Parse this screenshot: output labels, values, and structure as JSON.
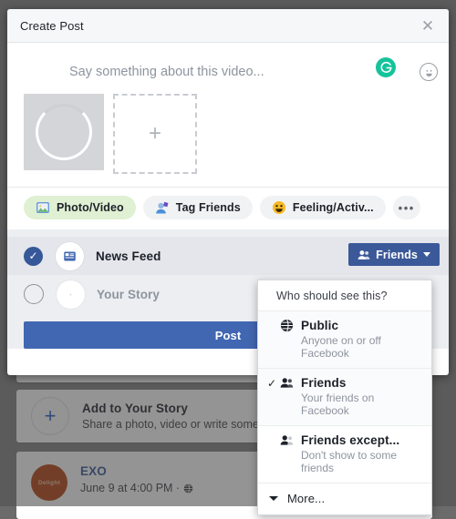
{
  "modal": {
    "title": "Create Post",
    "close_icon": "close-icon",
    "composer": {
      "placeholder": "Say something about this video...",
      "grammarly_icon": "grammarly-icon",
      "grammarly_glyph": "G",
      "emoji_icon": "emoji-smiley-icon"
    },
    "media": {
      "thumbnail_state": "uploading-spinner",
      "add_more_glyph": "+",
      "add_more_icon": "plus-icon"
    },
    "attachments": [
      {
        "label": "Photo/Video",
        "icon": "photo-video-icon",
        "active": true
      },
      {
        "label": "Tag Friends",
        "icon": "tag-friends-icon",
        "active": false
      },
      {
        "label": "Feeling/Activ...",
        "icon": "feeling-activity-icon",
        "active": false
      }
    ],
    "attachments_more_glyph": "•••",
    "audience": [
      {
        "label": "News Feed",
        "icon": "news-feed-icon",
        "selected": true
      },
      {
        "label": "Your Story",
        "icon": "your-story-icon",
        "selected": false
      }
    ],
    "privacy_button": {
      "label": "Friends",
      "icon": "friends-icon"
    },
    "post_button": {
      "label": "Post"
    }
  },
  "privacy_menu": {
    "heading": "Who should see this?",
    "options": [
      {
        "title": "Public",
        "subtitle": "Anyone on or off Facebook",
        "icon": "globe-icon",
        "checked": false
      },
      {
        "title": "Friends",
        "subtitle": "Your friends on Facebook",
        "icon": "friends-icon",
        "checked": true
      },
      {
        "title": "Friends except...",
        "subtitle": "Don't show to some friends",
        "icon": "friends-except-icon",
        "checked": false
      }
    ],
    "more": {
      "label": "More...",
      "icon": "chevron-down-icon"
    },
    "check_glyph": "✓"
  },
  "background": {
    "story_card": {
      "title": "Add to Your Story",
      "subtitle": "Share a photo, video or write something",
      "plus_glyph": "+",
      "plus_icon": "plus-icon"
    },
    "feed_post": {
      "author": "EXO",
      "timestamp": "June 9 at 4:00 PM ·",
      "privacy_icon": "globe-icon",
      "avatar_text": "Delight",
      "more_glyph": "•••"
    }
  },
  "colors": {
    "facebook_blue": "#3b5998",
    "post_button_blue": "#4267b2",
    "grammarly_green": "#15c39a",
    "photo_pill_green": "#dff0d3",
    "avatar_orange": "#b7410e"
  }
}
